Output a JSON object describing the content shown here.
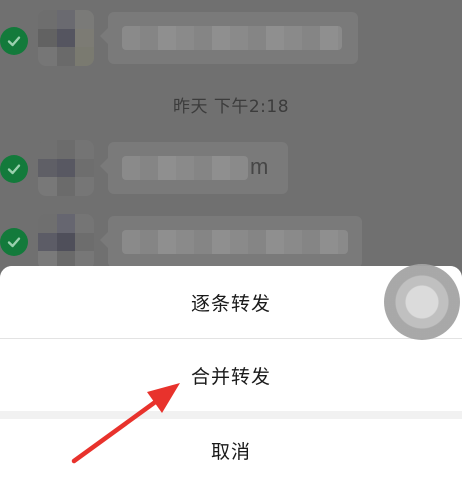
{
  "chat": {
    "timestamp": "昨天 下午2:18",
    "messages": [
      {
        "visible_text": ""
      },
      {
        "visible_text": "m"
      },
      {
        "visible_text": ""
      }
    ]
  },
  "action_sheet": {
    "items": [
      {
        "label": "逐条转发"
      },
      {
        "label": "合并转发"
      }
    ],
    "cancel_label": "取消"
  },
  "colors": {
    "overlay": "#707070",
    "selected_check": "#137a3b",
    "sheet_background": "#ffffff",
    "arrow": "#e8322c"
  },
  "icons": {
    "selection": "check-circle-icon",
    "floating_button": "assistive-touch-icon"
  }
}
